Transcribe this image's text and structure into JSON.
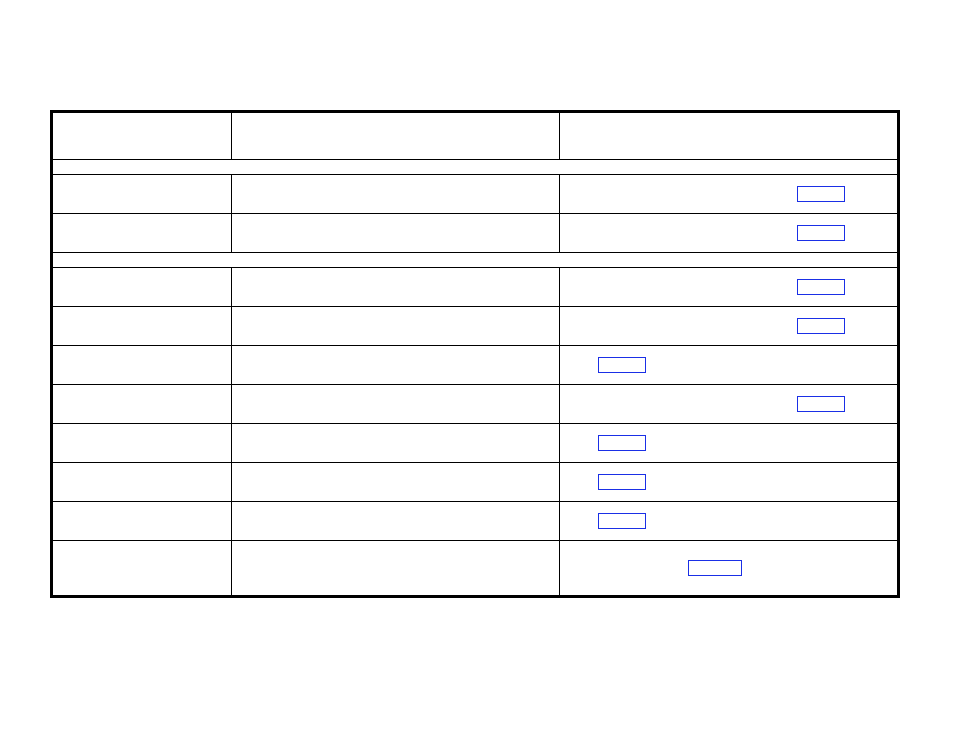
{
  "table": {
    "header": {
      "col_a": "",
      "col_b": "",
      "col_c": ""
    },
    "sections": [
      {
        "heading": "",
        "rows": [
          {
            "a": "",
            "b": "",
            "c_text": "",
            "box": "right"
          },
          {
            "a": "",
            "b": "",
            "c_text": "",
            "box": "right"
          }
        ]
      },
      {
        "heading": "",
        "rows": [
          {
            "a": "",
            "b": "",
            "c_text": "",
            "box": "right"
          },
          {
            "a": "",
            "b": "",
            "c_text": "",
            "box": "right"
          },
          {
            "a": "",
            "b": "",
            "c_text": "",
            "box": "left"
          },
          {
            "a": "",
            "b": "",
            "c_text": "",
            "box": "right"
          },
          {
            "a": "",
            "b": "",
            "c_text": "",
            "box": "left"
          },
          {
            "a": "",
            "b": "",
            "c_text": "",
            "box": "left"
          },
          {
            "a": "",
            "b": "",
            "c_text": "",
            "box": "left"
          },
          {
            "a": "",
            "b": "",
            "c_text": "",
            "box": "mid",
            "tall": true
          }
        ]
      }
    ]
  }
}
